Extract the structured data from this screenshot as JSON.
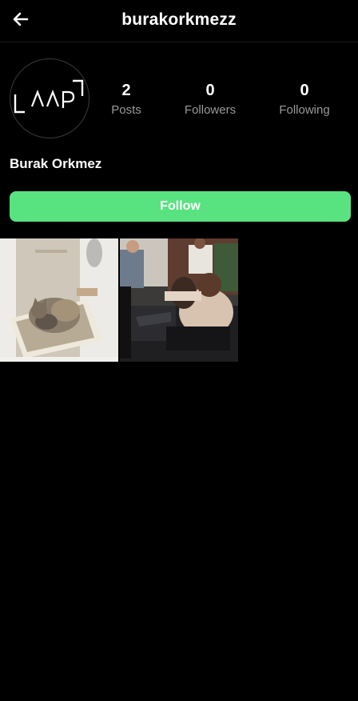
{
  "header": {
    "title": "burakorkmezz",
    "back_icon": "arrow-left-icon"
  },
  "profile": {
    "avatar_logo_text": "AAP",
    "display_name": "Burak Orkmez",
    "stats": [
      {
        "value": "2",
        "label": "Posts"
      },
      {
        "value": "0",
        "label": "Followers"
      },
      {
        "value": "0",
        "label": "Following"
      }
    ],
    "follow_label": "Follow"
  },
  "posts": [
    {
      "subject": "cat"
    },
    {
      "subject": "people-at-computers"
    }
  ],
  "colors": {
    "background": "#000000",
    "accent": "#58e380",
    "muted_text": "#9a9a9a"
  }
}
